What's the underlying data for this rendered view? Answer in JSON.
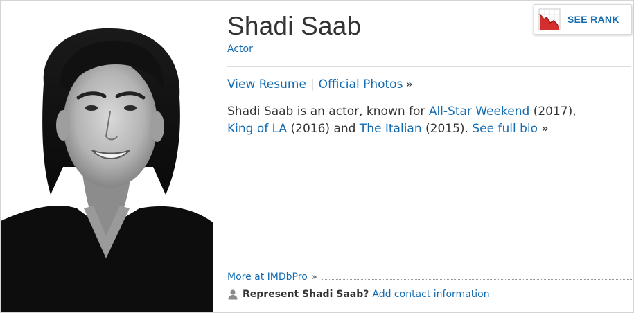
{
  "person": {
    "name": "Shadi Saab",
    "job": "Actor",
    "photo_icon": "headshot-photo"
  },
  "links": {
    "view_resume": "View Resume",
    "separator": "|",
    "official_photos": "Official Photos",
    "raquo": "»"
  },
  "bio": {
    "prefix": "Shadi Saab is an actor, known for ",
    "film1": "All-Star Weekend",
    "year1": " (2017),",
    "film2": "King of LA",
    "year2": " (2016) and ",
    "film3": "The Italian",
    "year3": " (2015). ",
    "see_full_bio": "See full bio",
    "raquo": "»"
  },
  "imdbpro": {
    "more_label": "More at IMDbPro",
    "raquo": "»"
  },
  "represent": {
    "icon": "user-icon",
    "question": "Represent Shadi Saab?",
    "add_contact": "Add contact information"
  },
  "rank_button": {
    "icon": "rank-chart-icon",
    "label": "SEE RANK",
    "accent": "#d32f2f"
  },
  "colors": {
    "link": "#136cb2",
    "text": "#333333",
    "border": "#d4d4d4"
  }
}
